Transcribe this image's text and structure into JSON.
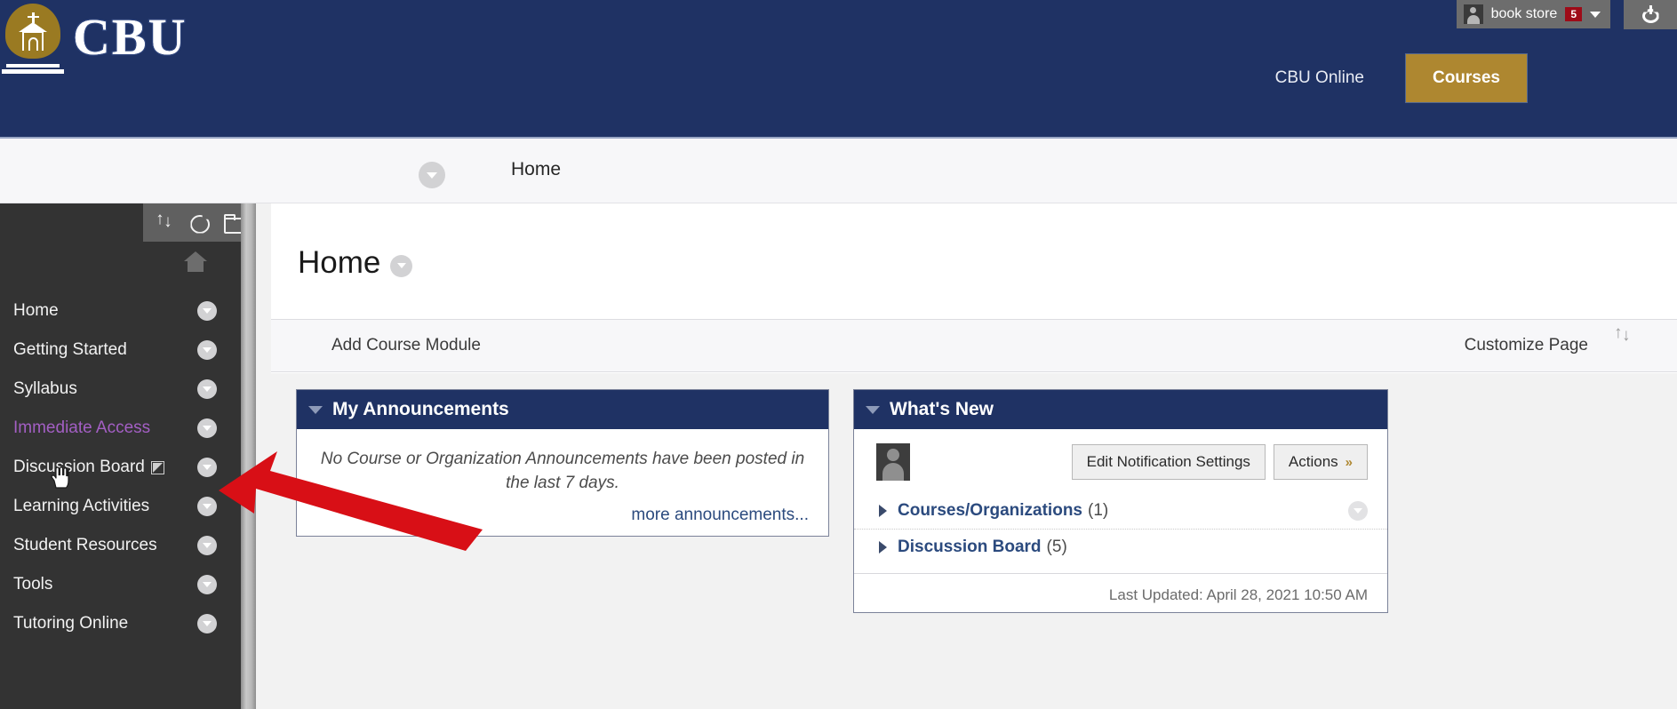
{
  "header": {
    "brand_text": "CBU",
    "brand_icon": "chapel-logo-icon",
    "user": {
      "name": "book store",
      "badge": "5",
      "avatar_icon": "user-avatar-icon",
      "caret_icon": "chevron-down-icon"
    },
    "power_icon": "power-logout-icon",
    "tabs": [
      {
        "label": "CBU Online",
        "active": false
      },
      {
        "label": "Courses",
        "active": true
      }
    ],
    "colors": {
      "navy": "#1f3264",
      "gold": "#ae8730",
      "badge_red": "#9e0b18"
    }
  },
  "breadcrumb": {
    "toggle_icon": "chevron-down-circle-icon",
    "label": "Home"
  },
  "sidebar": {
    "toolbar_icons": [
      "sort-arrows-icon",
      "refresh-icon",
      "folder-icon"
    ],
    "home_icon": "home-icon",
    "items": [
      {
        "label": "Home",
        "state": "normal",
        "external": false
      },
      {
        "label": "Getting Started",
        "state": "normal",
        "external": false
      },
      {
        "label": "Syllabus",
        "state": "normal",
        "external": false
      },
      {
        "label": "Immediate Access",
        "state": "visited",
        "external": false
      },
      {
        "label": "Discussion Board",
        "state": "normal",
        "external": true
      },
      {
        "label": "Learning Activities",
        "state": "normal",
        "external": false
      },
      {
        "label": "Student Resources",
        "state": "normal",
        "external": false
      },
      {
        "label": "Tools",
        "state": "normal",
        "external": false
      },
      {
        "label": "Tutoring Online",
        "state": "normal",
        "external": false
      }
    ],
    "item_chevron_icon": "chevron-down-circle-icon",
    "resize_handle_icon": "drag-handle-icon"
  },
  "main": {
    "page_title": "Home",
    "title_chevron_icon": "chevron-down-circle-icon",
    "action_bar": {
      "add_module_label": "Add Course Module",
      "customize_label": "Customize Page",
      "sort_icon": "sort-arrows-icon"
    },
    "modules": {
      "announcements": {
        "title": "My Announcements",
        "collapse_icon": "triangle-down-icon",
        "empty_text": "No Course or Organization Announcements have been posted in the last 7 days.",
        "more_link": "more announcements..."
      },
      "whats_new": {
        "title": "What's New",
        "collapse_icon": "triangle-down-icon",
        "avatar_icon": "user-avatar-icon",
        "buttons": [
          {
            "label": "Edit Notification Settings",
            "has_chevron": false
          },
          {
            "label": "Actions",
            "has_chevron": true,
            "chevron_icon": "double-chevron-down-icon"
          }
        ],
        "rows": [
          {
            "label": "Courses/Organizations",
            "count": "(1)",
            "expand_icon": "triangle-right-icon",
            "has_row_chevron": true
          },
          {
            "label": "Discussion Board",
            "count": "(5)",
            "expand_icon": "triangle-right-icon",
            "has_row_chevron": false
          }
        ],
        "last_updated": "Last Updated: April 28, 2021 10:50 AM"
      }
    }
  },
  "annotation": {
    "arrow_icon": "red-arrow-annotation",
    "color": "#d80f16"
  },
  "cursor": {
    "icon": "pointing-hand-cursor"
  }
}
